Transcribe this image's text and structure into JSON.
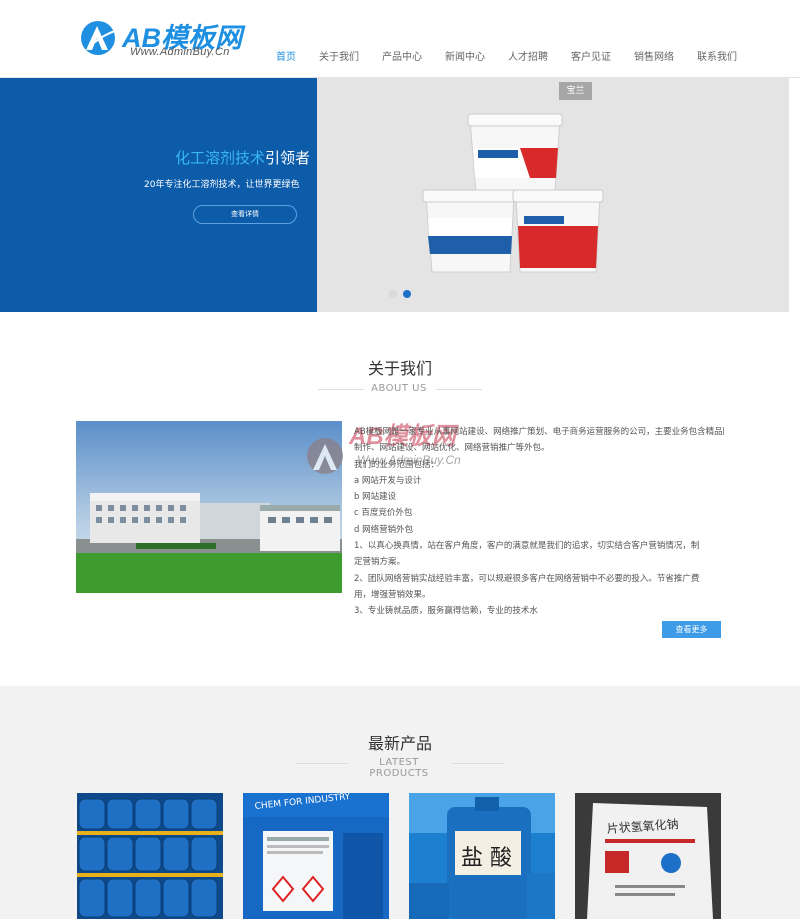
{
  "header": {
    "logo_text": "AB模板网",
    "logo_sub": "Www.AdminBuy.Cn",
    "nav": [
      "首页",
      "关于我们",
      "产品中心",
      "新闻中心",
      "人才招聘",
      "客户见证",
      "销售网络",
      "联系我们"
    ],
    "active_index": 0
  },
  "banner": {
    "title_highlight": "化工溶剂技术",
    "title_rest": "引领者",
    "subtitle": "20年专注化工溶剂技术，让世界更绿色",
    "button_label": "查看详情",
    "tag": "宝兰",
    "slides": 2,
    "active_slide": 2
  },
  "about": {
    "title": "关于我们",
    "subtitle": "ABOUT US",
    "paragraphs": [
      "AB模板网是一家专业从事网站建设、网络推广策划、电子商务运营服务的公司，主要业务包含精品网站",
      "制作、网站建设、网站优化、网络营销推广等外包。",
      "我们的业务范围包括：",
      "a  网站开发与设计",
      "b  网站建设",
      "c  百度竞价外包",
      "d  网络营销外包",
      "1、以真心换真情，站在客户角度，客户的满意就是我们的追求，切实结合客户营销情况，制",
      "定营销方案。",
      "2、团队网络营销实战经验丰富，可以规避很多客户在网络营销中不必要的投入。节省推广费",
      "用，增强营销效果。",
      "3、专业铸就品质，服务赢得信赖，专业的技术水"
    ],
    "more_button": "查看更多",
    "watermark_text": "AB模板网",
    "watermark_sub": "Www.AdminBuy.Cn"
  },
  "products": {
    "title": "最新产品",
    "subtitle": "LATEST PRODUCTS",
    "items": [
      {
        "name": "blue-drums"
      },
      {
        "name": "blue-drum-closeup",
        "label": "CHEM FOR INDUSTRY"
      },
      {
        "name": "hydrochloric-acid",
        "label": "盐 酸"
      },
      {
        "name": "bag-chemical",
        "label": "片状氢氧化钠"
      }
    ]
  },
  "colors": {
    "brand": "#1e8fe1",
    "banner_blue": "#0c5caa",
    "button_blue": "#3d9be8"
  }
}
